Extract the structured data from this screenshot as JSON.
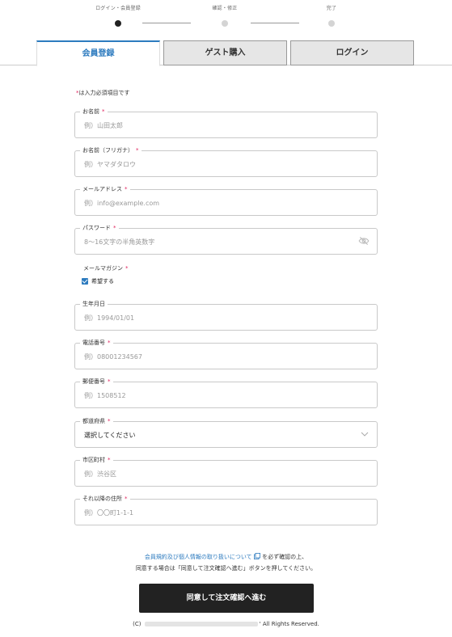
{
  "stepper": {
    "steps": [
      {
        "label": "ログイン・会員登録"
      },
      {
        "label": "確認・修正"
      },
      {
        "label": "完了"
      }
    ]
  },
  "tabs": [
    {
      "label": "会員登録",
      "active": true
    },
    {
      "label": "ゲスト購入",
      "active": false
    },
    {
      "label": "ログイン",
      "active": false
    }
  ],
  "form": {
    "required_note": "は入力必須項目です",
    "required_mark": "*",
    "fields": [
      {
        "label": "お名前",
        "required": true,
        "placeholder": "例）山田太郎"
      },
      {
        "label": "お名前（フリガナ）",
        "required": true,
        "placeholder": "例）ヤマダタロウ"
      },
      {
        "label": "メールアドレス",
        "required": true,
        "placeholder": "例）info@example.com"
      },
      {
        "label": "パスワード",
        "required": true,
        "placeholder": "8～16文字の半角英数字"
      },
      {
        "label": "生年月日",
        "required": false,
        "placeholder": "例）1994/01/01"
      },
      {
        "label": "電話番号",
        "required": true,
        "placeholder": "例）08001234567"
      },
      {
        "label": "郵便番号",
        "required": true,
        "placeholder": "例）1508512"
      },
      {
        "label": "都道府県",
        "required": true,
        "value": "選択してください"
      },
      {
        "label": "市区町村",
        "required": true,
        "placeholder": "例）渋谷区"
      },
      {
        "label": "それ以降の住所",
        "required": true,
        "placeholder": "例）〇〇町1-1-1"
      }
    ],
    "magazine": {
      "label": "メールマガジン",
      "option": "希望する",
      "checked": true
    }
  },
  "notice": {
    "link_text": "会員規約及び個人情報の取り扱いについて",
    "line1_suffix": "を必ず確認の上、",
    "line2": "同意する場合は「同意して注文確認へ進む」ボタンを押してください。"
  },
  "submit_label": "同意して注文確認へ進む",
  "footer": {
    "prefix": "(C)",
    "suffix": "' All Rights Reserved."
  },
  "colors": {
    "accent": "#2d7bbf",
    "required": "#e0245e",
    "button": "#222222"
  }
}
